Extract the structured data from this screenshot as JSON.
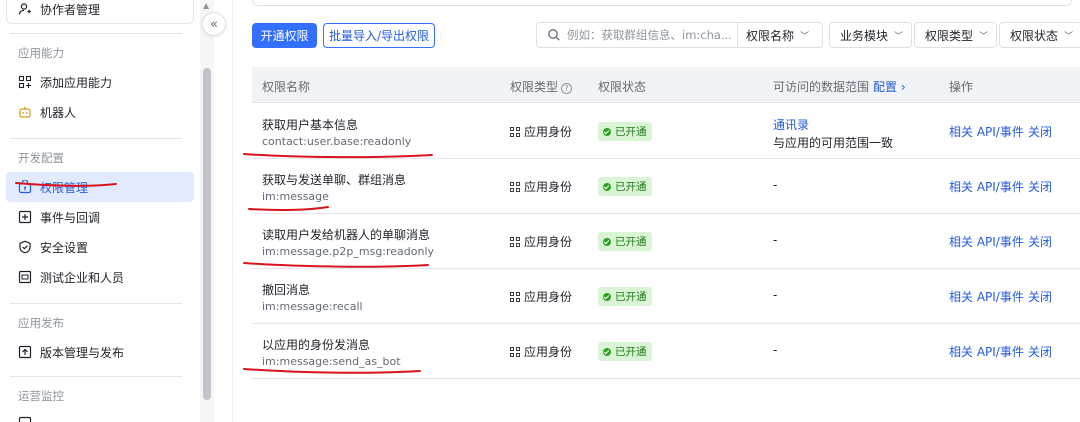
{
  "sidebar": {
    "top_item": "协作者管理",
    "sections": [
      {
        "title": "应用能力",
        "items": [
          {
            "label": "添加应用能力",
            "icon": "apps-grid-icon"
          },
          {
            "label": "机器人",
            "icon": "robot-icon"
          }
        ]
      },
      {
        "title": "开发配置",
        "items": [
          {
            "label": "权限管理",
            "icon": "key-lock-icon",
            "active": true
          },
          {
            "label": "事件与回调",
            "icon": "event-callback-icon"
          },
          {
            "label": "安全设置",
            "icon": "shield-icon"
          },
          {
            "label": "测试企业和人员",
            "icon": "test-box-icon"
          }
        ]
      },
      {
        "title": "应用发布",
        "items": [
          {
            "label": "版本管理与发布",
            "icon": "upload-version-icon"
          }
        ]
      },
      {
        "title": "运营监控",
        "items": []
      }
    ]
  },
  "toolbar": {
    "enable_button": "开通权限",
    "batch_button": "批量导入/导出权限",
    "search_placeholder": "例如：获取群组信息、im:cha...",
    "search_select": "权限名称",
    "filters": [
      "业务模块",
      "权限类型",
      "权限状态"
    ]
  },
  "table": {
    "headers": {
      "name": "权限名称",
      "type": "权限类型",
      "status": "权限状态",
      "range": "可访问的数据范围",
      "range_config": "配置",
      "ops": "操作"
    },
    "rows": [
      {
        "name": "获取用户基本信息",
        "code": "contact:user.base:readonly",
        "type": "应用身份",
        "status": "已开通",
        "range_link": "通讯录",
        "range_text": "与应用的可用范围一致",
        "api": "相关 API/事件",
        "close": "关闭"
      },
      {
        "name": "获取与发送单聊、群组消息",
        "code": "im:message",
        "type": "应用身份",
        "status": "已开通",
        "range_text": "-",
        "api": "相关 API/事件",
        "close": "关闭"
      },
      {
        "name": "读取用户发给机器人的单聊消息",
        "code": "im:message.p2p_msg:readonly",
        "type": "应用身份",
        "status": "已开通",
        "range_text": "-",
        "api": "相关 API/事件",
        "close": "关闭"
      },
      {
        "name": "撤回消息",
        "code": "im:message:recall",
        "type": "应用身份",
        "status": "已开通",
        "range_text": "-",
        "api": "相关 API/事件",
        "close": "关闭"
      },
      {
        "name": "以应用的身份发消息",
        "code": "im:message:send_as_bot",
        "type": "应用身份",
        "status": "已开通",
        "range_text": "-",
        "api": "相关 API/事件",
        "close": "关闭"
      }
    ]
  },
  "colors": {
    "primary": "#3370ff",
    "link": "#245bdb",
    "success_bg": "#d9f5d6",
    "success_text": "#237b19",
    "annotation_red": "#d9141d"
  }
}
